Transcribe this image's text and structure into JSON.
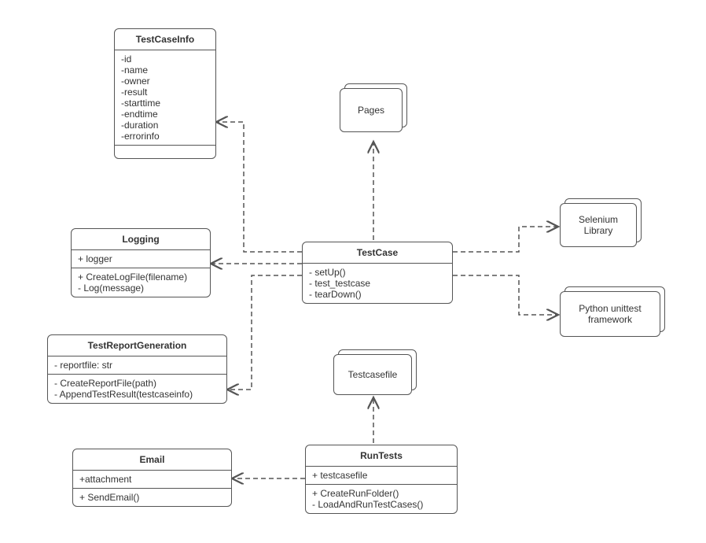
{
  "classes": {
    "testcaseinfo": {
      "title": "TestCaseInfo",
      "attrs": [
        "-id",
        "-name",
        "-owner",
        "-result",
        "-starttime",
        "-endtime",
        "-duration",
        "-errorinfo"
      ]
    },
    "logging": {
      "title": "Logging",
      "attrs": [
        "+ logger"
      ],
      "ops": [
        "+ CreateLogFile(filename)",
        "- Log(message)"
      ]
    },
    "testreportgen": {
      "title": "TestReportGeneration",
      "attrs": [
        "- reportfile: str"
      ],
      "ops": [
        "- CreateReportFile(path)",
        "- AppendTestResult(testcaseinfo)"
      ]
    },
    "email": {
      "title": "Email",
      "attrs": [
        "+attachment"
      ],
      "ops": [
        "+ SendEmail()"
      ]
    },
    "testcase": {
      "title": "TestCase",
      "ops": [
        "- setUp()",
        "- test_testcase",
        "- tearDown()"
      ]
    },
    "runtests": {
      "title": "RunTests",
      "attrs": [
        "+ testcasefile"
      ],
      "ops": [
        "+ CreateRunFolder()",
        "- LoadAndRunTestCases()"
      ]
    }
  },
  "packages": {
    "pages": "Pages",
    "testcasefile": "Testcasefile",
    "selenium": "Selenium Library",
    "pyunit": "Python unittest framework"
  }
}
